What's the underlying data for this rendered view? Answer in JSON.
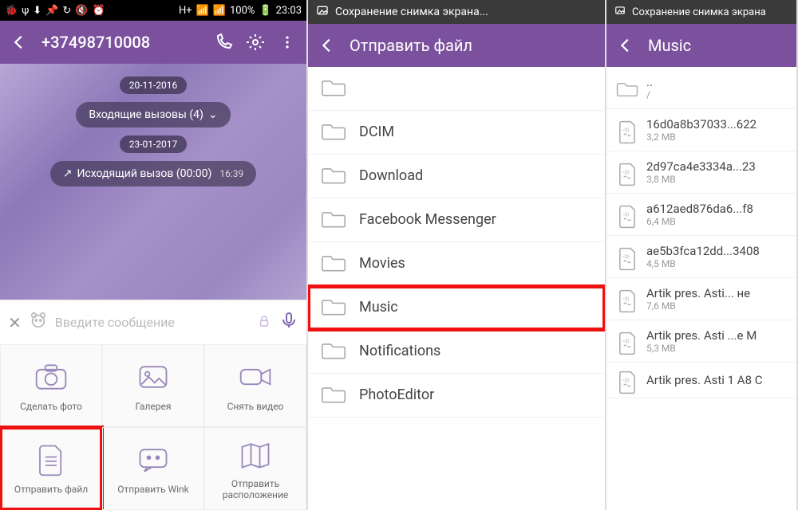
{
  "statusbar": {
    "time": "23:03",
    "battery": "100%"
  },
  "s1": {
    "header_phone": "+37498710008",
    "date1": "20-11-2016",
    "incoming": "Входящие вызовы  (4)",
    "date2": "23-01-2017",
    "outgoing": "Исходящий вызов  (00:00)",
    "outgoing_time": "16:39",
    "input_placeholder": "Введите сообщение",
    "grid": [
      {
        "label": "Сделать фото",
        "icon": "camera"
      },
      {
        "label": "Галерея",
        "icon": "gallery"
      },
      {
        "label": "Снять видео",
        "icon": "video"
      },
      {
        "label": "Отправить файл",
        "icon": "file"
      },
      {
        "label": "Отправить Wink",
        "icon": "wink"
      },
      {
        "label": "Отправить расположение",
        "icon": "map"
      }
    ]
  },
  "s2": {
    "notif": "Сохранение снимка экрана...",
    "header": "Отправить файл",
    "items": [
      {
        "name": "",
        "sub": "<DIR>"
      },
      {
        "name": "DCIM",
        "sub": "<DIR>"
      },
      {
        "name": "Download",
        "sub": "<DIR>"
      },
      {
        "name": "Facebook Messenger",
        "sub": "<DIR>"
      },
      {
        "name": "Movies",
        "sub": "<DIR>"
      },
      {
        "name": "Music",
        "sub": "<DIR>",
        "highlight": true
      },
      {
        "name": "Notifications",
        "sub": "<DIR>"
      },
      {
        "name": "PhotoEditor",
        "sub": "<DIR>"
      }
    ]
  },
  "s3": {
    "notif": "Сохранение снимка экрана",
    "header": "Music",
    "items": [
      {
        "name": "..",
        "sub": "/",
        "icon": "folder"
      },
      {
        "name": "16d0a8b37033...622",
        "sub": "3,2 MB",
        "icon": "audio"
      },
      {
        "name": "2d97ca4e3334a...23",
        "sub": "3,8 MB",
        "icon": "audio"
      },
      {
        "name": "a612aed876da6...f8",
        "sub": "6,4 MB",
        "icon": "audio"
      },
      {
        "name": "ae5b3fca12dd...3408",
        "sub": "4,5 MB",
        "icon": "audio"
      },
      {
        "name": "Artik pres. Asti... не",
        "sub": "7,6 MB",
        "icon": "audio"
      },
      {
        "name": "Artik pres. Asti ...e M",
        "sub": "5,3 MB",
        "icon": "audio"
      },
      {
        "name": "Artik pres. Asti 1 A8 C",
        "sub": "",
        "icon": "audio"
      }
    ]
  }
}
